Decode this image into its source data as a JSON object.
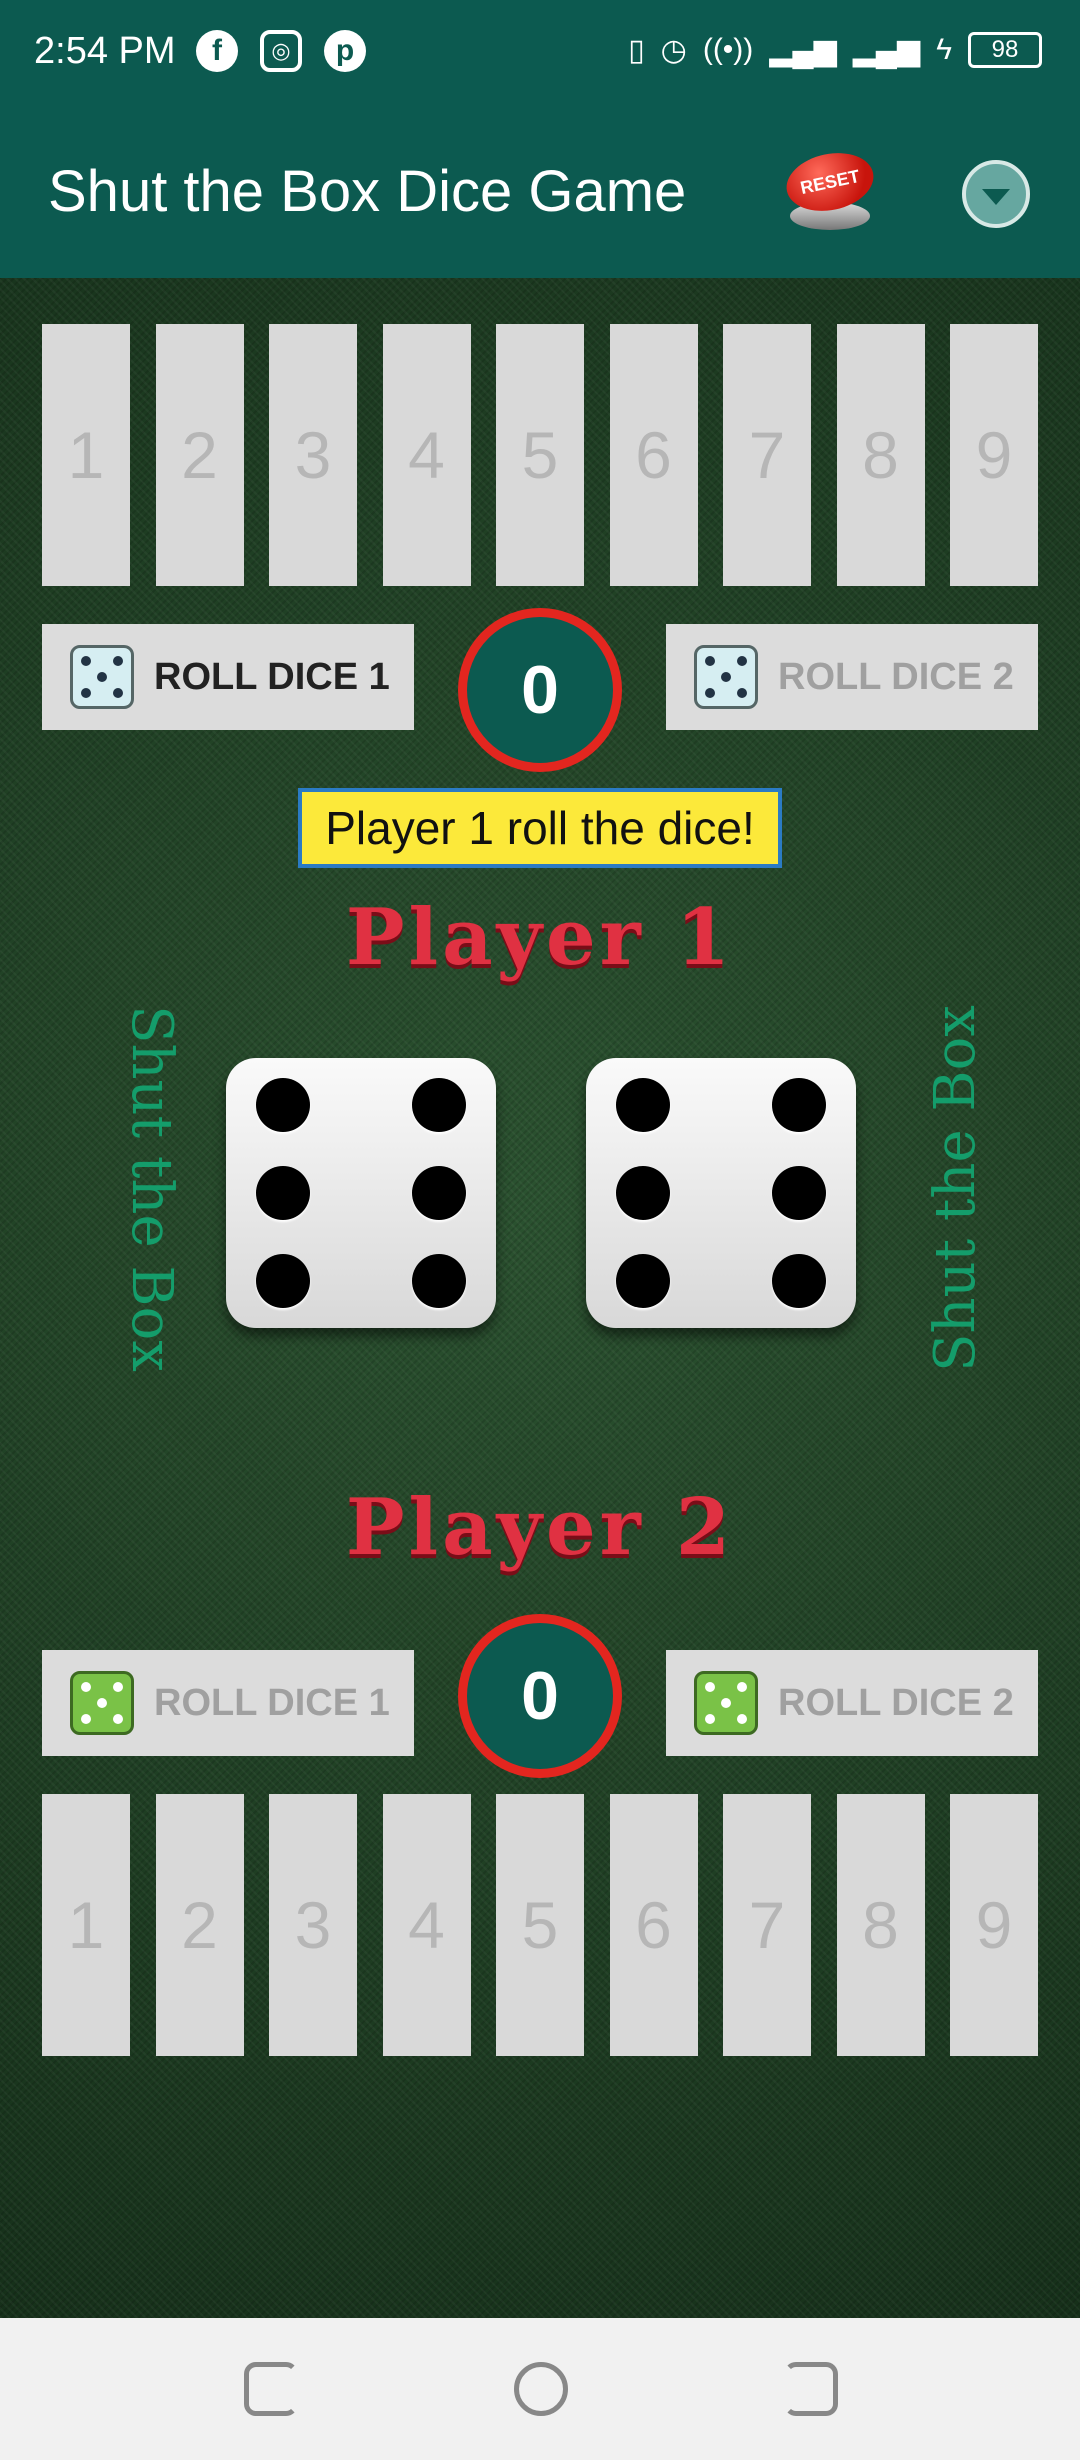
{
  "status_bar": {
    "time": "2:54 PM",
    "battery": "98",
    "left_icons": [
      "facebook-icon",
      "instagram-icon",
      "pinterest-icon"
    ],
    "right_icons": [
      "vibrate-icon",
      "alarm-icon",
      "hotspot-icon",
      "signal-icon",
      "signal-icon",
      "charging-icon",
      "battery-icon"
    ]
  },
  "app_bar": {
    "title": "Shut the Box Dice Game",
    "reset_label": "RESET"
  },
  "player1": {
    "tiles": [
      "1",
      "2",
      "3",
      "4",
      "5",
      "6",
      "7",
      "8",
      "9"
    ],
    "roll_dice_1": "ROLL DICE 1",
    "roll_dice_2": "ROLL DICE 2",
    "score": "0",
    "label": "Player 1"
  },
  "message": "Player 1 roll the dice!",
  "dice": {
    "die1": 6,
    "die2": 6
  },
  "side_text": {
    "left": "Shut the Box",
    "right": "Shut the Box"
  },
  "player2": {
    "label": "Player 2",
    "roll_dice_1": "ROLL DICE 1",
    "roll_dice_2": "ROLL DICE 2",
    "score": "0",
    "tiles": [
      "1",
      "2",
      "3",
      "4",
      "5",
      "6",
      "7",
      "8",
      "9"
    ]
  },
  "colors": {
    "app_bar": "#0c5a50",
    "score_ring": "#e3261f",
    "player_label": "#e03142",
    "message_bg": "#fce93a"
  }
}
